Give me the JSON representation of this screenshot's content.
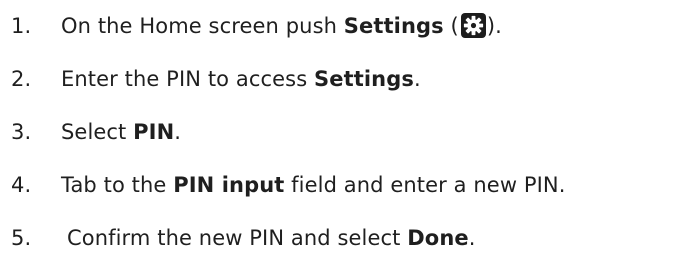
{
  "steps": [
    {
      "number": "1.",
      "text_before": "On the Home screen push ",
      "bold": "Settings",
      "paren_open": " (",
      "icon": "gear-icon",
      "text_after": ")."
    },
    {
      "number": "2.",
      "text_before": "Enter the PIN to access ",
      "bold": "Settings",
      "text_after": "."
    },
    {
      "number": "3.",
      "text_before": "Select ",
      "bold": "PIN",
      "text_after": "."
    },
    {
      "number": "4.",
      "text_before": "Tab to the ",
      "bold": "PIN input",
      "text_after": " field and enter a new PIN."
    },
    {
      "number": "5.",
      "text_before": "Confirm the new PIN and select ",
      "bold": "Done",
      "text_after": "."
    }
  ],
  "colors": {
    "text": "#1f1f1f",
    "icon_background": "#1d1d1d",
    "icon_foreground": "#ffffff"
  }
}
